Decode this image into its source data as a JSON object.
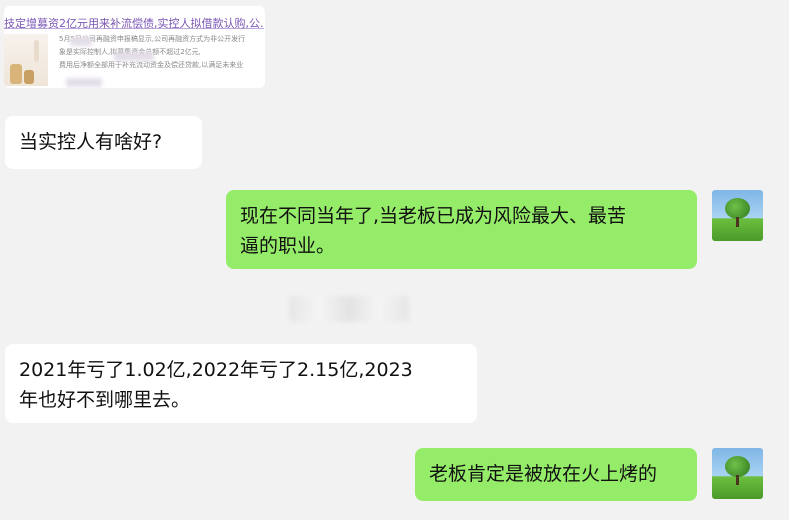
{
  "link_card": {
    "title": "技定增募资2亿元用来补流偿债,实控人拟借款认购,公...",
    "desc_lines": [
      "5月5日公司再融资申报稿显示,公司再融资方式为非公开发行",
      "象是实际控制人,拟募集资金总额不超过2亿元,",
      "费用后净额全部用于补充流动资金及偿还贷款,以满足未来业"
    ]
  },
  "messages": [
    {
      "side": "left",
      "text": "当实控人有啥好?"
    },
    {
      "side": "right",
      "text": "现在不同当年了,当老板已成为风险最大、最苦逼的职业。",
      "line1": "现在不同当年了,当老板已成为风险最大、最苦",
      "line2": "逼的职业。"
    },
    {
      "side": "left",
      "text": "2021年亏了1.02亿,2022年亏了2.15亿,2023年也好不到哪里去。",
      "line1": "2021年亏了1.02亿,2022年亏了2.15亿,2023",
      "line2": "年也好不到哪里去。"
    },
    {
      "side": "right",
      "text": "老板肯定是被放在火上烤的"
    }
  ],
  "colors": {
    "background": "#f2f2f2",
    "self_bubble": "#95ec69",
    "other_bubble": "#ffffff",
    "link_title": "#7a55b5"
  },
  "icons": {
    "self_avatar": "tree-landscape-avatar"
  }
}
